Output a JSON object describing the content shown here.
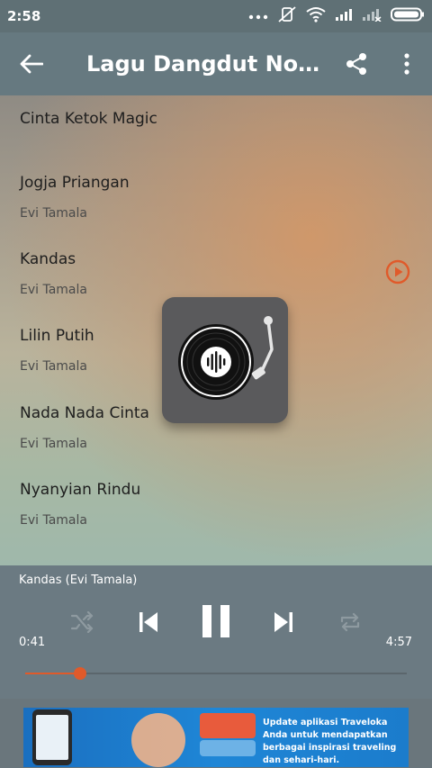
{
  "status_bar": {
    "time": "2:58"
  },
  "app_bar": {
    "title": "Lagu Dangdut Nost…"
  },
  "songs": [
    {
      "name": "Cinta Ketok Magic",
      "artist": ""
    },
    {
      "name": "Jogja Priangan",
      "artist": "Evi Tamala"
    },
    {
      "name": "Kandas",
      "artist": "Evi Tamala"
    },
    {
      "name": "Lilin Putih",
      "artist": "Evi Tamala"
    },
    {
      "name": "Nada Nada Cinta",
      "artist": "Evi Tamala"
    },
    {
      "name": "Nyanyian Rindu",
      "artist": "Evi Tamala"
    }
  ],
  "player": {
    "now_playing": "Kandas (Evi Tamala)",
    "current_time": "0:41",
    "total_time": "4:57",
    "progress": 0.145
  },
  "ad": {
    "copy": "Update aplikasi Traveloka Anda untuk mendapatkan berbagai inspirasi traveling dan sehari-hari."
  },
  "colors": {
    "accent": "#e05a2a",
    "app_bar": "#667980",
    "player_bg": "#6b7a82"
  }
}
